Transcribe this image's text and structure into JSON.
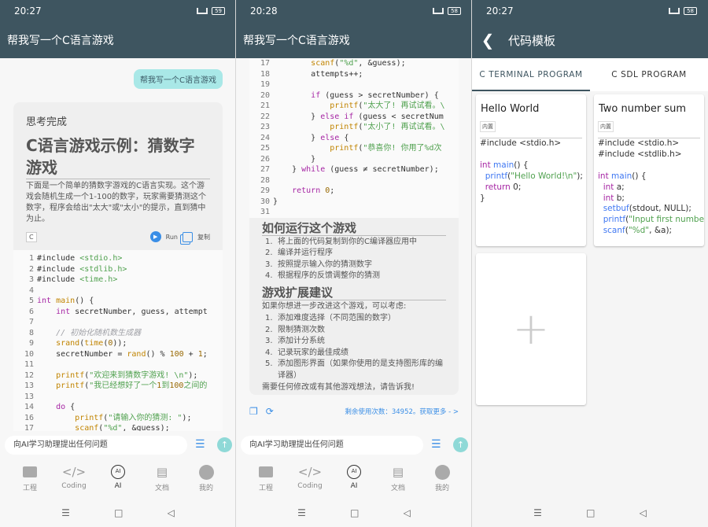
{
  "status": [
    {
      "time": "20:27",
      "battery": "59"
    },
    {
      "time": "20:28",
      "battery": "58"
    },
    {
      "time": "20:27",
      "battery": "58"
    }
  ],
  "chat_title": "帮我写一个C语言游戏",
  "screen1": {
    "user_message": "帮我写一个C语言游戏",
    "thinking": "思考完成",
    "heading": "C语言游戏示例：猜数字游戏",
    "intro": "下面是一个简单的猜数字游戏的C语言实现。这个游戏会随机生成一个1-100的数字，玩家需要猜测这个数字，程序会给出\"太大\"或\"太小\"的提示，直到猜中为止。",
    "lang": "C",
    "run_label": "Run",
    "copy_label": "复制",
    "code": [
      {
        "n": "1",
        "t": "#include <stdio.h>"
      },
      {
        "n": "2",
        "t": "#include <stdlib.h>"
      },
      {
        "n": "3",
        "t": "#include <time.h>"
      },
      {
        "n": "4",
        "t": ""
      },
      {
        "n": "5",
        "t": "int main() {"
      },
      {
        "n": "6",
        "t": "    int secretNumber, guess, attempt"
      },
      {
        "n": "7",
        "t": ""
      },
      {
        "n": "8",
        "t": "    // 初始化随机数生成器"
      },
      {
        "n": "9",
        "t": "    srand(time(0));"
      },
      {
        "n": "10",
        "t": "    secretNumber = rand() % 100 + 1;"
      },
      {
        "n": "11",
        "t": ""
      },
      {
        "n": "12",
        "t": "    printf(\"欢迎来到猜数字游戏! \\n\");"
      },
      {
        "n": "13",
        "t": "    printf(\"我已经想好了一个1到100之间的"
      },
      {
        "n": "13",
        "t": ""
      },
      {
        "n": "14",
        "t": "    do {"
      },
      {
        "n": "16",
        "t": "        printf(\"请输入你的猜测: \");"
      },
      {
        "n": "17",
        "t": "        scanf(\"%d\", &guess);"
      }
    ]
  },
  "screen2": {
    "code": [
      {
        "n": "17",
        "t": "        scanf(\"%d\", &guess);"
      },
      {
        "n": "18",
        "t": "        attempts++;"
      },
      {
        "n": "19",
        "t": ""
      },
      {
        "n": "20",
        "t": "        if (guess > secretNumber) {"
      },
      {
        "n": "21",
        "t": "            printf(\"太大了! 再试试看。\\"
      },
      {
        "n": "22",
        "t": "        } else if (guess < secretNum"
      },
      {
        "n": "23",
        "t": "            printf(\"太小了! 再试试看。\\"
      },
      {
        "n": "24",
        "t": "        } else {"
      },
      {
        "n": "25",
        "t": "            printf(\"恭喜你! 你用了%d次"
      },
      {
        "n": "26",
        "t": "        }"
      },
      {
        "n": "27",
        "t": "    } while (guess ≠ secretNumber);"
      },
      {
        "n": "28",
        "t": ""
      },
      {
        "n": "29",
        "t": "    return 0;"
      },
      {
        "n": "30",
        "t": "}"
      },
      {
        "n": "31",
        "t": ""
      }
    ],
    "how_title": "如何运行这个游戏",
    "how_steps": [
      "将上面的代码复制到你的C编译器应用中",
      "编译并运行程序",
      "按照提示输入你的猜测数字",
      "根据程序的反馈调整你的猜测"
    ],
    "ext_title": "游戏扩展建议",
    "ext_intro": "如果你想进一步改进这个游戏，可以考虑:",
    "ext_items": [
      "添加难度选择（不同范围的数字）",
      "限制猜测次数",
      "添加计分系统",
      "记录玩家的最佳成绩",
      "添加图形界面（如果你使用的是支持图形库的编译器）"
    ],
    "closing": "需要任何修改或有其他游戏想法，请告诉我!",
    "usage": "剩余使用次数：34952。获取更多 - >"
  },
  "input_placeholder": "向AI学习助理提出任何问题",
  "nav": [
    "工程",
    "Coding",
    "AI",
    "文档",
    "我的"
  ],
  "screen3": {
    "title": "代码模板",
    "tabs": [
      "C TERMINAL PROGRAM",
      "C SDL PROGRAM"
    ],
    "badge": "内置",
    "hello_name": "Hello World",
    "sum_name": "Two number sum",
    "add_label": "+"
  },
  "colors": {
    "appbar": "#3e5560",
    "accent": "#3a8ee6",
    "bubble": "#a9e8e7"
  }
}
